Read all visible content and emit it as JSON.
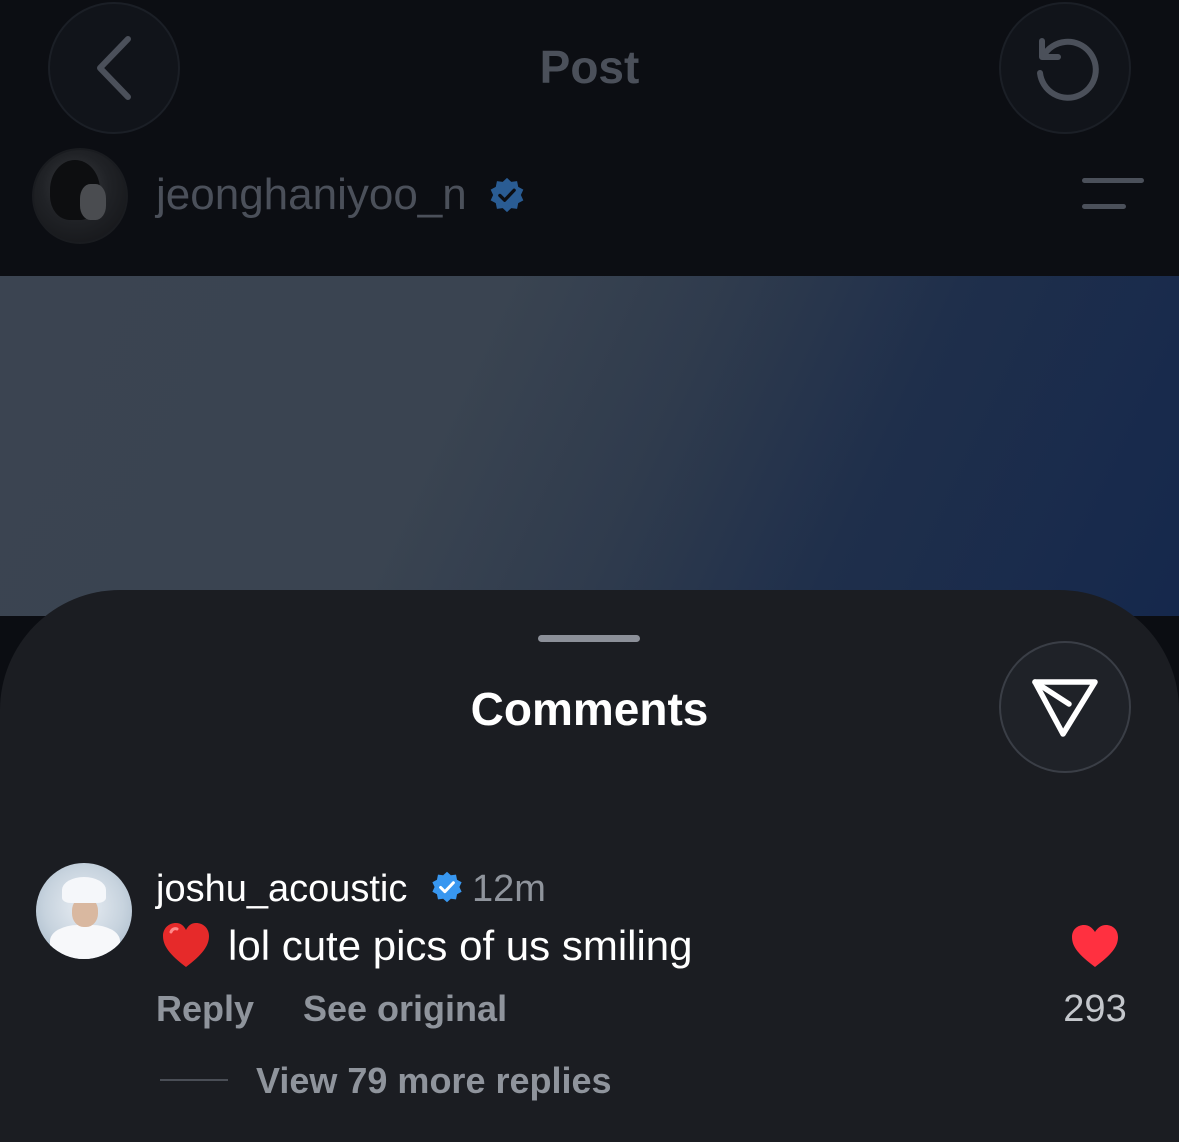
{
  "header": {
    "title": "Post",
    "back_icon": "chevron-left-icon",
    "refresh_icon": "refresh-icon"
  },
  "post": {
    "author": "jeonghaniyoo_n",
    "verified": true,
    "menu_icon": "menu-icon"
  },
  "comments_sheet": {
    "title": "Comments",
    "share_icon": "send-icon",
    "comments": [
      {
        "username": "joshu_acoustic",
        "verified": true,
        "time": "12m",
        "emoji": "❤️",
        "text": "lol cute pics of us smiling",
        "reply_label": "Reply",
        "see_original_label": "See original",
        "like_count": "293",
        "liked": true,
        "view_replies_label": "View 79 more replies"
      }
    ]
  },
  "colors": {
    "verified_blue": "#3897f0",
    "like_red": "#ff3040",
    "sheet_bg": "#1b1d22"
  }
}
